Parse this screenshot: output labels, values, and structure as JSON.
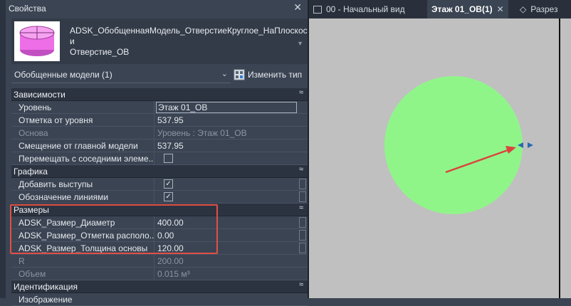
{
  "panel": {
    "title": "Свойства",
    "type_name": "ADSK_ОбобщеннаяМодель_ОтверстиеКруглое_НаПлоскости",
    "type_line1": "ADSK_ОбобщеннаяМодель_ОтверстиеКруглое_НаПлоскост",
    "type_line2": "и",
    "type_line3": "Отверстие_ОВ",
    "selector_value": "Обобщенные модели (1)",
    "edit_type_label": "Изменить тип"
  },
  "groups": {
    "constraints": {
      "label": "Зависимости",
      "rows": [
        {
          "name": "Уровень",
          "value": "Этаж 01_ОВ"
        },
        {
          "name": "Отметка от уровня",
          "value": "537.95"
        },
        {
          "name": "Основа",
          "value": "Уровень : Этаж 01_ОВ"
        },
        {
          "name": "Смещение от главной модели",
          "value": "537.95"
        },
        {
          "name": "Перемещать с соседними элеме...",
          "value": ""
        }
      ]
    },
    "graphics": {
      "label": "Графика",
      "rows": [
        {
          "name": "Добавить выступы",
          "checked": true
        },
        {
          "name": "Обозначение линиями",
          "checked": true
        }
      ]
    },
    "dimensions": {
      "label": "Размеры",
      "rows": [
        {
          "name": "ADSK_Размер_Диаметр",
          "value": "400.00"
        },
        {
          "name": "ADSK_Размер_Отметка располо...",
          "value": "0.00"
        },
        {
          "name": "ADSK_Размер_Толщина основы",
          "value": "120.00"
        },
        {
          "name": "R",
          "value": "200.00"
        },
        {
          "name": "Объем",
          "value": "0.015 м³"
        }
      ]
    },
    "identity": {
      "label": "Идентификация",
      "rows": [
        {
          "name": "Изображение",
          "value": ""
        }
      ]
    }
  },
  "view": {
    "tabs": [
      {
        "label": "00 - Начальный вид"
      },
      {
        "label": "Этаж 01_ОВ(1)"
      },
      {
        "label": "Разрез"
      }
    ],
    "circle_color": "#90f589",
    "arrow_color": "#d9453d"
  },
  "icons": {
    "collapse": "collapse-icon",
    "close": "close-icon",
    "edit_type": "edit-type-icon"
  }
}
